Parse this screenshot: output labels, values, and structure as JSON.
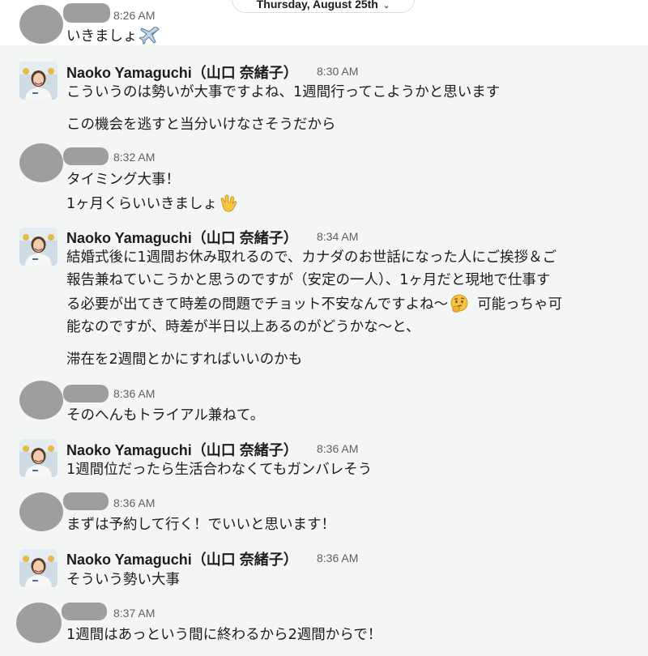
{
  "date_divider": {
    "label": "Thursday, August 25th",
    "caret": "⌄"
  },
  "messages": [
    {
      "sender": "",
      "time": "8:26 AM",
      "lines": [
        "いきましょ"
      ]
    },
    {
      "sender": "Naoko Yamaguchi（山口 奈緒子）",
      "time": "8:30 AM",
      "lines": [
        "こういうのは勢いが大事ですよね、1週間行ってこようかと思います",
        "この機会を逃すと当分いけなさそうだから"
      ]
    },
    {
      "sender": "",
      "time": "8:32 AM",
      "lines": [
        "タイミング大事！",
        "1ヶ月くらいいきましょ"
      ]
    },
    {
      "sender": "Naoko Yamaguchi（山口 奈緒子）",
      "time": "8:34 AM",
      "lines": [
        "結婚式後に1週間お休み取れるので、カナダのお世話になった人にご挨拶＆ご",
        "報告兼ねていこうかと思うのですが（安定の一人）、1ヶ月だと現地で仕事す",
        "る必要が出てきて時差の問題でチョット不安なんですよね〜",
        "可能っちゃ可",
        "能なのですが、時差が半日以上あるのがどうかな〜と、",
        "滞在を2週間とかにすればいいのかも"
      ]
    },
    {
      "sender": "",
      "time": "8:36 AM",
      "lines": [
        "そのへんもトライアル兼ねて。"
      ]
    },
    {
      "sender": "Naoko Yamaguchi（山口 奈緒子）",
      "time": "8:36 AM",
      "lines": [
        "1週間位だったら生活合わなくてもガンバレそう"
      ]
    },
    {
      "sender": "",
      "time": "8:36 AM",
      "lines": [
        "まずは予約して行く！でいいと思います！"
      ]
    },
    {
      "sender": "Naoko Yamaguchi（山口 奈緒子）",
      "time": "8:36 AM",
      "lines": [
        "そういう勢い大事"
      ]
    },
    {
      "sender": "",
      "time": "8:37 AM",
      "lines": [
        "1週間はあっという間に終わるから2週間からで！"
      ]
    }
  ],
  "icons": {
    "airplane": "airplane-emoji-icon",
    "love_you_gesture": "love-you-gesture-emoji-icon",
    "thinking_face": "thinking-face-emoji-icon"
  }
}
